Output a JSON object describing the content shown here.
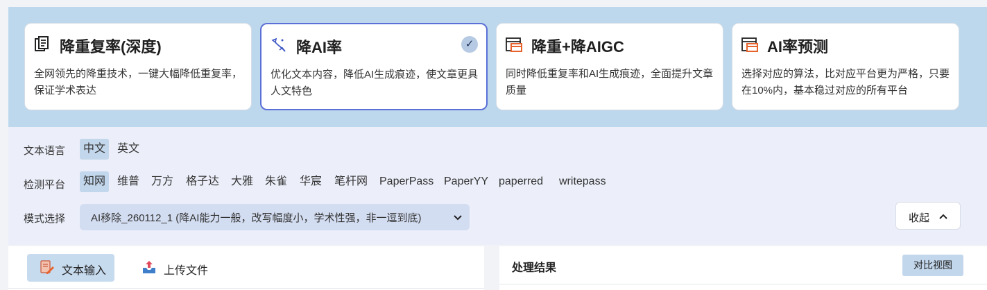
{
  "cards": [
    {
      "title": "降重复率(深度)",
      "desc": "全网领先的降重技术，一键大幅降低重复率，保证学术表达",
      "icon": "document-stack-icon",
      "selected": false
    },
    {
      "title": "降AI率",
      "desc": "优化文本内容，降低AI生成痕迹，使文章更具人文特色",
      "icon": "sparkle-wand-icon",
      "selected": true,
      "check": "✓"
    },
    {
      "title": "降重+降AIGC",
      "desc": "同时降低重复率和AI生成痕迹，全面提升文章质量",
      "icon": "browser-window-icon",
      "selected": false
    },
    {
      "title": "AI率预测",
      "desc": "选择对应的算法，比对应平台更为严格，只要在10%内，基本稳过对应的所有平台",
      "icon": "browser-window-icon",
      "selected": false
    }
  ],
  "options": {
    "language": {
      "label": "文本语言",
      "items": [
        "中文",
        "英文"
      ],
      "selected": "中文"
    },
    "platform": {
      "label": "检测平台",
      "items": [
        "知网",
        "维普",
        "万方",
        "格子达",
        "大雅",
        "朱雀",
        "华宸",
        "笔杆网",
        "PaperPass",
        "PaperYY",
        "paperred",
        "writepass"
      ],
      "selected": "知网"
    },
    "mode": {
      "label": "模式选择",
      "value": "AI移除_260112_1 (降AI能力一般，改写幅度小，学术性强，非一逗到底)"
    },
    "collapse_label": "收起"
  },
  "input_tabs": [
    {
      "label": "文本输入",
      "icon": "edit-document-icon",
      "active": true
    },
    {
      "label": "上传文件",
      "icon": "upload-tray-icon",
      "active": false
    }
  ],
  "result": {
    "title": "处理结果",
    "compare_label": "对比视图"
  },
  "colors": {
    "accent": "#5b6fd6",
    "chip_active": "#c2d6ec",
    "card_band": "#bdd8ec",
    "icon_orange": "#e8622c"
  }
}
